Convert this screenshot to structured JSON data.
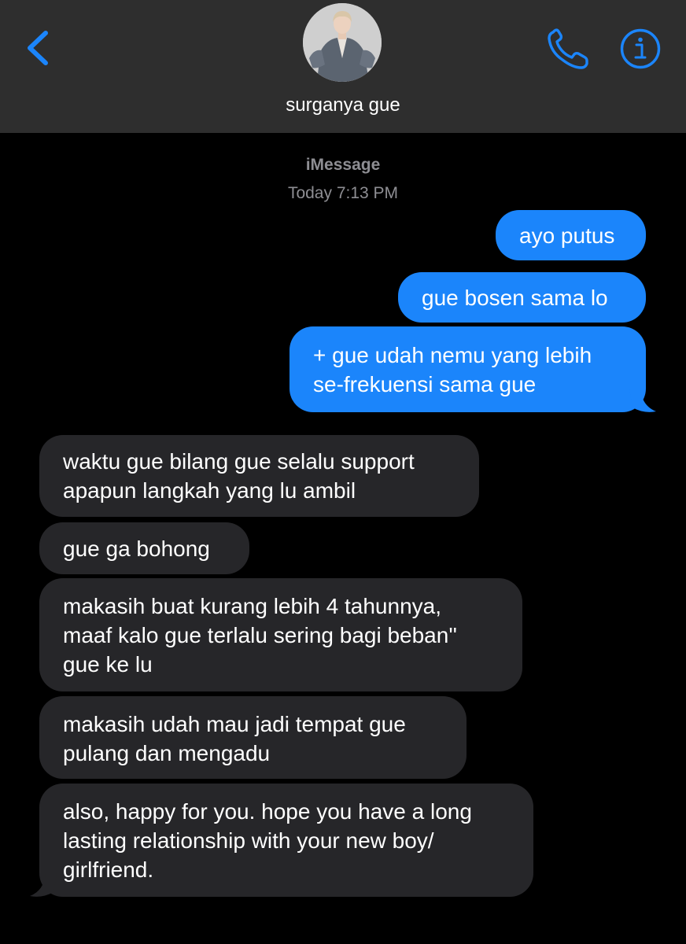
{
  "header": {
    "contact_name": "surganya gue",
    "accent_color": "#1b85fb",
    "back_icon": "chevron-left-icon",
    "call_icon": "phone-icon",
    "info_icon": "info-icon"
  },
  "thread": {
    "service": "iMessage",
    "timestamp": "Today 7:13 PM"
  },
  "messages": {
    "sent": [
      {
        "lines": [
          "ayo putus"
        ]
      },
      {
        "lines": [
          "gue bosen sama lo"
        ]
      },
      {
        "lines": [
          "+ gue udah nemu yang lebih",
          "se-frekuensi sama gue"
        ]
      }
    ],
    "received": [
      {
        "lines": [
          "waktu gue bilang gue selalu support",
          "apapun langkah yang lu ambil"
        ]
      },
      {
        "lines": [
          "gue ga bohong"
        ]
      },
      {
        "lines": [
          "makasih buat kurang lebih 4 tahunnya,",
          "maaf kalo gue terlalu sering bagi beban''",
          "gue ke lu"
        ]
      },
      {
        "lines": [
          "makasih udah mau jadi tempat gue",
          "pulang dan mengadu"
        ]
      },
      {
        "lines": [
          "also, happy for you. hope you have a long",
          "lasting relationship with your new boy/",
          "girlfriend."
        ]
      }
    ]
  }
}
